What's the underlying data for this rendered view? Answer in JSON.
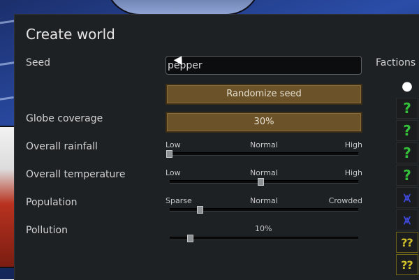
{
  "dialog": {
    "title": "Create world"
  },
  "seed": {
    "label": "Seed",
    "value": "pepper",
    "randomize_label": "Randomize seed"
  },
  "globe_coverage": {
    "label": "Globe coverage",
    "value": "30%"
  },
  "rainfall": {
    "label": "Overall rainfall",
    "scale": [
      "Low",
      "Normal",
      "High"
    ],
    "level": 0
  },
  "temperature": {
    "label": "Overall temperature",
    "scale": [
      "Low",
      "Normal",
      "High"
    ],
    "level": 0.5
  },
  "population": {
    "label": "Population",
    "scale": [
      "Sparse",
      "Normal",
      "Crowded"
    ],
    "level": 0.17
  },
  "pollution": {
    "label": "Pollution",
    "value_label": "10%",
    "level": 0.1
  },
  "factions": {
    "title": "Factions",
    "icons": [
      {
        "name": "player-faction-icon",
        "glyph": "●"
      },
      {
        "name": "random-faction-icon",
        "glyph": "?"
      },
      {
        "name": "random-faction-icon",
        "glyph": "?"
      },
      {
        "name": "random-faction-icon",
        "glyph": "?"
      },
      {
        "name": "random-faction-icon",
        "glyph": "?"
      },
      {
        "name": "mechanoid-faction-icon",
        "glyph": "⩙"
      },
      {
        "name": "mechanoid-faction-icon",
        "glyph": "⩙"
      },
      {
        "name": "unknown-faction-icon",
        "glyph": "⁇"
      },
      {
        "name": "unknown-faction-icon",
        "glyph": "⁇"
      }
    ]
  }
}
